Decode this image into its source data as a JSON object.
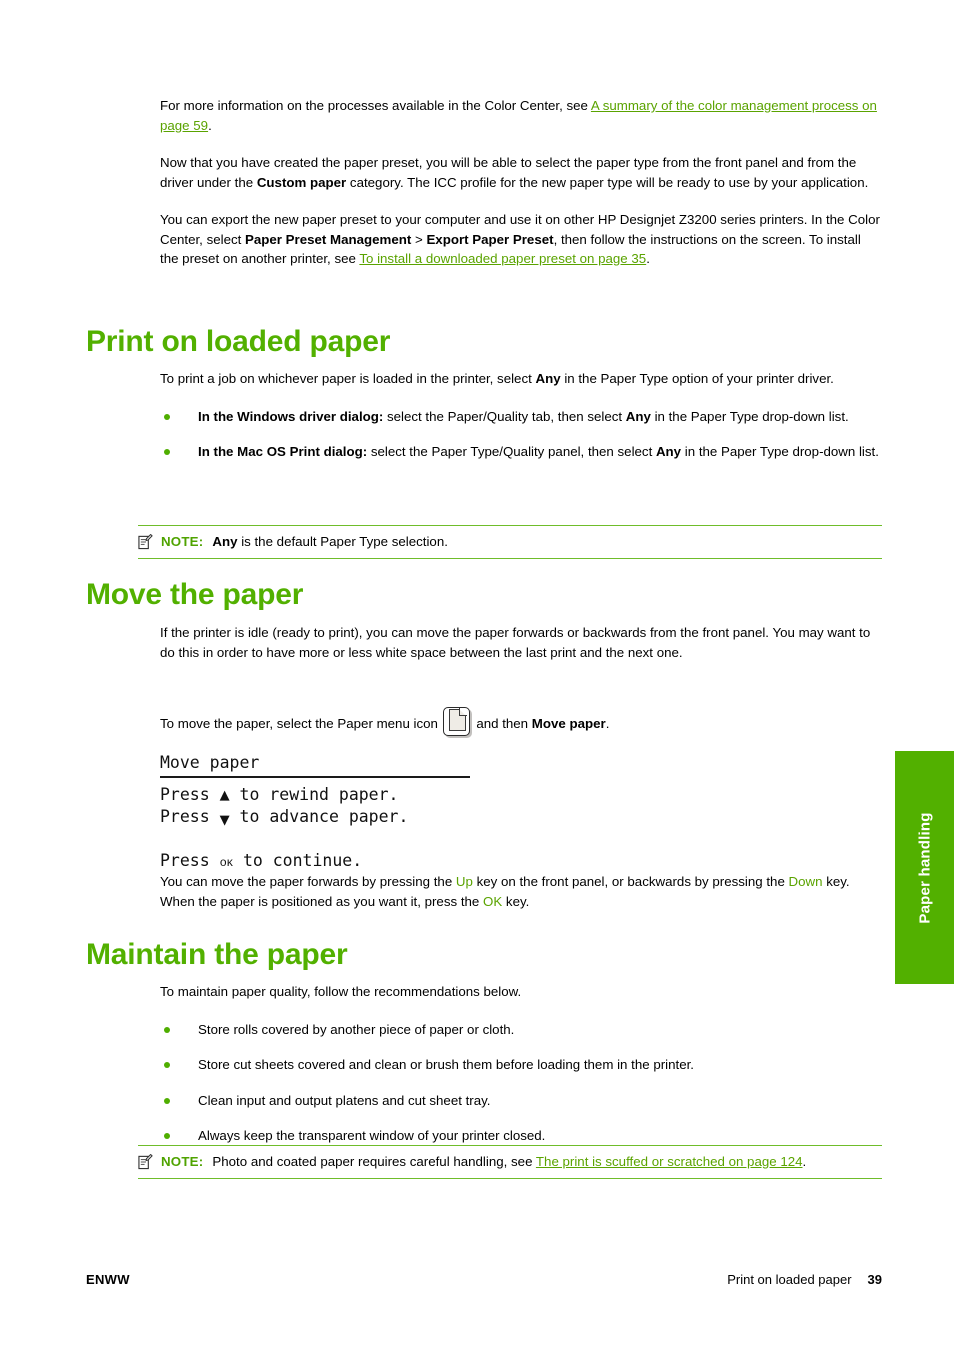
{
  "page": {
    "footer_left": "ENWW",
    "footer_section": "Print on loaded paper",
    "footer_page_number": "39",
    "side_tab_label": "Paper handling",
    "accent_green": "#52b000",
    "link_green": "#5aa300",
    "bullet_green": "#4fae00"
  },
  "intro": {
    "para1_a": "For more information on the processes available in the Color Center, see ",
    "para1_link": "A summary of the color management process on page 59",
    "para1_b": ".",
    "para2_a": "Now that you have created the paper preset, you will be able to select the paper type from the front panel and from the driver under the ",
    "para2_bold": "Custom paper",
    "para2_b": " category. The ICC profile for the new paper type will be ready to use by your application.",
    "para3_a": "You can export the new paper preset to your computer and use it on other HP Designjet Z3200 series printers. In the Color Center, select ",
    "para3_bold1": "Paper Preset Management",
    "para3_mid": " > ",
    "para3_bold2": "Export Paper Preset",
    "para3_b": ", then follow the instructions on the screen. To install the preset on another printer, see ",
    "para3_link": "To install a downloaded paper preset on page 35",
    "para3_c": "."
  },
  "section_print": {
    "heading": "Print on loaded paper",
    "intro_a": "To print a job on whichever paper is loaded in the printer, select ",
    "intro_bold": "Any",
    "intro_b": " in the Paper Type option of your printer driver.",
    "bullets": [
      {
        "bold": "In the Windows driver dialog:",
        "rest_a": " select the Paper/Quality tab, then select ",
        "bold2": "Any",
        "rest_b": " in the Paper Type drop-down list."
      },
      {
        "bold": "In the Mac OS Print dialog:",
        "rest_a": " select the Paper Type/Quality panel, then select ",
        "bold2": "Any",
        "rest_b": " in the Paper Type drop-down list."
      }
    ],
    "note": {
      "label": "NOTE:",
      "bold": "Any",
      "text": " is the default Paper Type selection.",
      "icon": "note-pencil-icon"
    }
  },
  "section_move": {
    "heading": "Move the paper",
    "para1": "If the printer is idle (ready to print), you can move the paper forwards or backwards from the front panel. You may want to do this in order to have more or less white space between the last print and the next one.",
    "para2_a": "To move the paper, select the Paper menu icon ",
    "para2_icon": "paper-menu-icon",
    "para2_b": " and then ",
    "para2_bold": "Move paper",
    "para2_c": ".",
    "front_panel": {
      "title": "Move paper",
      "line1_pre": "Press ",
      "line1_arrow": "▲",
      "line1_post": " to rewind paper.",
      "line2_pre": "Press ",
      "line2_arrow": "▼",
      "line2_post": " to advance paper.",
      "line3_pre": "Press ",
      "line3_key": "ᴏᴋ",
      "line3_post": " to continue."
    },
    "para3_a": "You can move the paper forwards by pressing the ",
    "para3_key1": "Up",
    "para3_b": " key on the front panel, or backwards by pressing the ",
    "para3_key2": "Down",
    "para3_c": " key. When the paper is positioned as you want it, press the ",
    "para3_key3": "OK",
    "para3_d": " key."
  },
  "section_maintain": {
    "heading": "Maintain the paper",
    "intro": "To maintain paper quality, follow the recommendations below.",
    "bullets": [
      "Store rolls covered by another piece of paper or cloth.",
      "Store cut sheets covered and clean or brush them before loading them in the printer.",
      "Clean input and output platens and cut sheet tray.",
      "Always keep the transparent window of your printer closed."
    ],
    "note": {
      "label": "NOTE:",
      "text_a": "Photo and coated paper requires careful handling, see ",
      "link": "The print is scuffed or scratched on page 124",
      "text_b": ".",
      "icon": "note-pencil-icon"
    }
  }
}
